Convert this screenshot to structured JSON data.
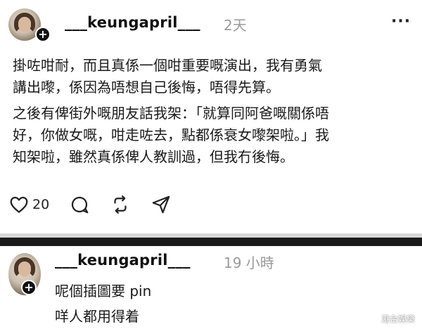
{
  "post": {
    "username": "___keungapril___",
    "time": "2天",
    "more_icon": "more-dots-icon",
    "paragraph1_line1": "掛咗咁耐，而且真係一個咁重要嘅演出，我有勇氣",
    "paragraph1_line2": "講出嚟，係因為唔想自己後悔，唔得先算。",
    "paragraph2_line1": "之後有俾街外嘅朋友話我架：「就算同阿爸嘅關係唔",
    "paragraph2_line2": "好，你做女嘅，咁走咗去，點都係衰女嚟架啦。」我",
    "paragraph2_line3": "知架啦，雖然真係俾人教訓過，但我冇後悔。",
    "like_count": "20",
    "actions": [
      "heart-icon",
      "comment-icon",
      "repost-icon",
      "share-icon"
    ]
  },
  "reply": {
    "username": "___keungapril___",
    "time": "19 小時",
    "line1": "呢個插圖要 pin",
    "line2": "咩人都用得着"
  },
  "watermark": "港台娛樂"
}
